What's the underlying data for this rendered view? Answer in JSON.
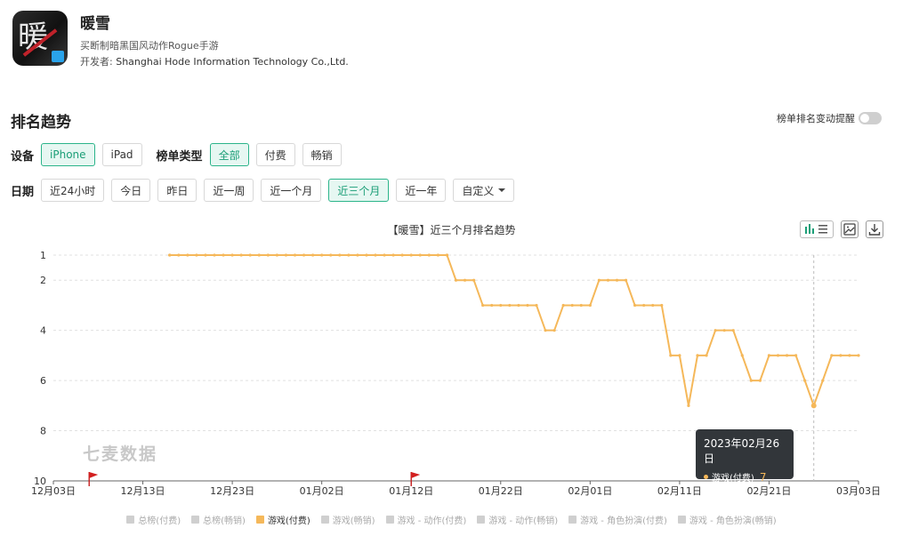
{
  "app": {
    "name": "暖雪",
    "description": "买断制暗黑国风动作Rogue手游",
    "developer_label": "开发者:",
    "developer": "Shanghai Hode Information Technology Co.,Ltd."
  },
  "section": {
    "title": "排名趋势",
    "alert_label": "榜单排名变动提醒"
  },
  "filters": {
    "device_label": "设备",
    "devices": [
      "iPhone",
      "iPad"
    ],
    "device_active": "iPhone",
    "type_label": "榜单类型",
    "types": [
      "全部",
      "付费",
      "畅销"
    ],
    "type_active": "全部",
    "date_label": "日期",
    "dates": [
      "近24小时",
      "今日",
      "昨日",
      "近一周",
      "近一个月",
      "近三个月",
      "近一年",
      "自定义"
    ],
    "date_active": "近三个月"
  },
  "watermark": "七麦数据",
  "colors": {
    "accent": "#1b9e77",
    "series": "#f5b85a"
  },
  "icons": [
    "bar-list-icon",
    "image-icon",
    "download-icon",
    "flag-icon"
  ],
  "tooltip": {
    "date": "2023年02月26日",
    "series": "游戏(付费)",
    "value": "7"
  },
  "chart_data": {
    "type": "line",
    "title": "【暖雪】近三个月排名趋势",
    "x_ticks": [
      "12月03日",
      "12月13日",
      "12月23日",
      "01月02日",
      "01月12日",
      "01月22日",
      "02月01日",
      "02月11日",
      "02月21日",
      "03月03日"
    ],
    "y_ticks": [
      "1",
      "2",
      "4",
      "6",
      "8",
      "10"
    ],
    "y_reversed": true,
    "xlim": [
      "2022-12-03",
      "2023-03-03"
    ],
    "ylim": [
      1,
      10
    ],
    "series": [
      {
        "name": "游戏(付费)",
        "x": [
          "2022-12-16",
          "2023-01-16",
          "2023-01-17",
          "2023-01-18",
          "2023-01-19",
          "2023-01-20",
          "2023-01-21",
          "2023-01-22",
          "2023-01-23",
          "2023-01-24",
          "2023-01-25",
          "2023-01-26",
          "2023-01-27",
          "2023-01-28",
          "2023-01-29",
          "2023-01-30",
          "2023-01-31",
          "2023-02-01",
          "2023-02-02",
          "2023-02-03",
          "2023-02-04",
          "2023-02-05",
          "2023-02-06",
          "2023-02-07",
          "2023-02-08",
          "2023-02-09",
          "2023-02-10",
          "2023-02-11",
          "2023-02-12",
          "2023-02-13",
          "2023-02-14",
          "2023-02-15",
          "2023-02-16",
          "2023-02-17",
          "2023-02-18",
          "2023-02-19",
          "2023-02-20",
          "2023-02-21",
          "2023-02-22",
          "2023-02-23",
          "2023-02-24",
          "2023-02-25",
          "2023-02-26",
          "2023-02-27",
          "2023-02-28",
          "2023-03-01",
          "2023-03-02",
          "2023-03-03"
        ],
        "values": [
          1,
          1,
          2,
          2,
          2,
          3,
          3,
          3,
          3,
          3,
          3,
          3,
          4,
          4,
          3,
          3,
          3,
          3,
          2,
          2,
          2,
          2,
          3,
          3,
          3,
          3,
          5,
          5,
          7,
          5,
          5,
          4,
          4,
          4,
          5,
          6,
          6,
          5,
          5,
          5,
          5,
          6,
          7,
          6,
          5,
          5,
          5,
          5
        ]
      }
    ],
    "annotations": [
      {
        "type": "flag",
        "x": "2022-12-07"
      },
      {
        "type": "flag",
        "x": "2023-01-12"
      }
    ],
    "grid": true,
    "legend": {
      "position": "bottom",
      "entries": [
        "总榜(付费)",
        "总榜(畅销)",
        "游戏(付费)",
        "游戏(畅销)",
        "游戏 - 动作(付费)",
        "游戏 - 动作(畅销)",
        "游戏 - 角色扮演(付费)",
        "游戏 - 角色扮演(畅销)"
      ],
      "active": "游戏(付费)"
    }
  }
}
